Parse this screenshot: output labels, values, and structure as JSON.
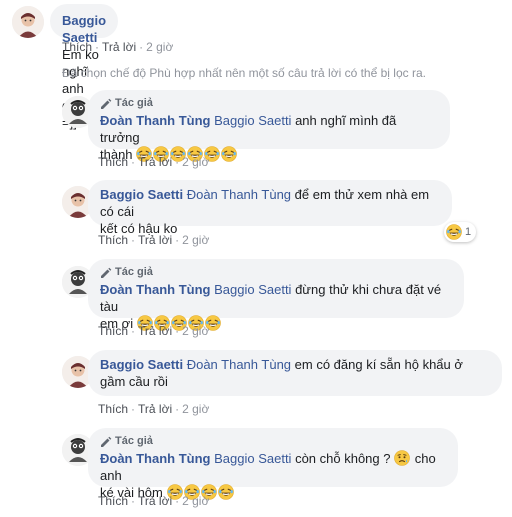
{
  "top_comment": {
    "author": "Baggio Saetti",
    "text": "Em ko nghĩ anh gan thế =]]",
    "actions": {
      "like": "Thích",
      "reply": "Trả lời",
      "time": "2 giờ"
    }
  },
  "filter_note": "Đã chọn chế độ Phù hợp nhất nên một số câu trả lời có thể bị lọc ra.",
  "replies": [
    {
      "badge": "Tác giả",
      "author": "Đoàn Thanh Tùng",
      "mention": "Baggio Saetti",
      "text_line1": "anh nghĩ mình đã trưởng",
      "text_line2": "thành",
      "actions": {
        "like": "Thích",
        "reply": "Trả lời",
        "time": "2 giờ"
      }
    },
    {
      "author": "Baggio Saetti",
      "mention": "Đoàn Thanh Tùng",
      "text_line1": "để em thử xem nhà em có cái",
      "text_line2": "kết có hậu ko",
      "reaction_count": "1",
      "actions": {
        "like": "Thích",
        "reply": "Trả lời",
        "time": "2 giờ"
      }
    },
    {
      "badge": "Tác giả",
      "author": "Đoàn Thanh Tùng",
      "mention": "Baggio Saetti",
      "text_line1": "đừng thử khi chưa đặt vé tàu",
      "text_line2": "em ơi",
      "actions": {
        "like": "Thích",
        "reply": "Trả lời",
        "time": "2 giờ"
      }
    },
    {
      "author": "Baggio Saetti",
      "mention": "Đoàn Thanh Tùng",
      "text_line1": "em có đăng kí sẵn hộ khẩu ở",
      "text_line2": "gầm cầu rồi",
      "actions": {
        "like": "Thích",
        "reply": "Trả lời",
        "time": "2 giờ"
      }
    },
    {
      "badge": "Tác giả",
      "author": "Đoàn Thanh Tùng",
      "mention": "Baggio Saetti",
      "text_line1": "còn chỗ không ?",
      "text_line1b": "cho anh",
      "text_line2": "ké vài hôm",
      "actions": {
        "like": "Thích",
        "reply": "Trả lời",
        "time": "2 giờ"
      }
    }
  ],
  "colors": {
    "link_blue": "#385898",
    "bubble_bg": "#f2f3f5",
    "meta_gray": "#90949c",
    "emoji_yellow": "#f7c843"
  }
}
